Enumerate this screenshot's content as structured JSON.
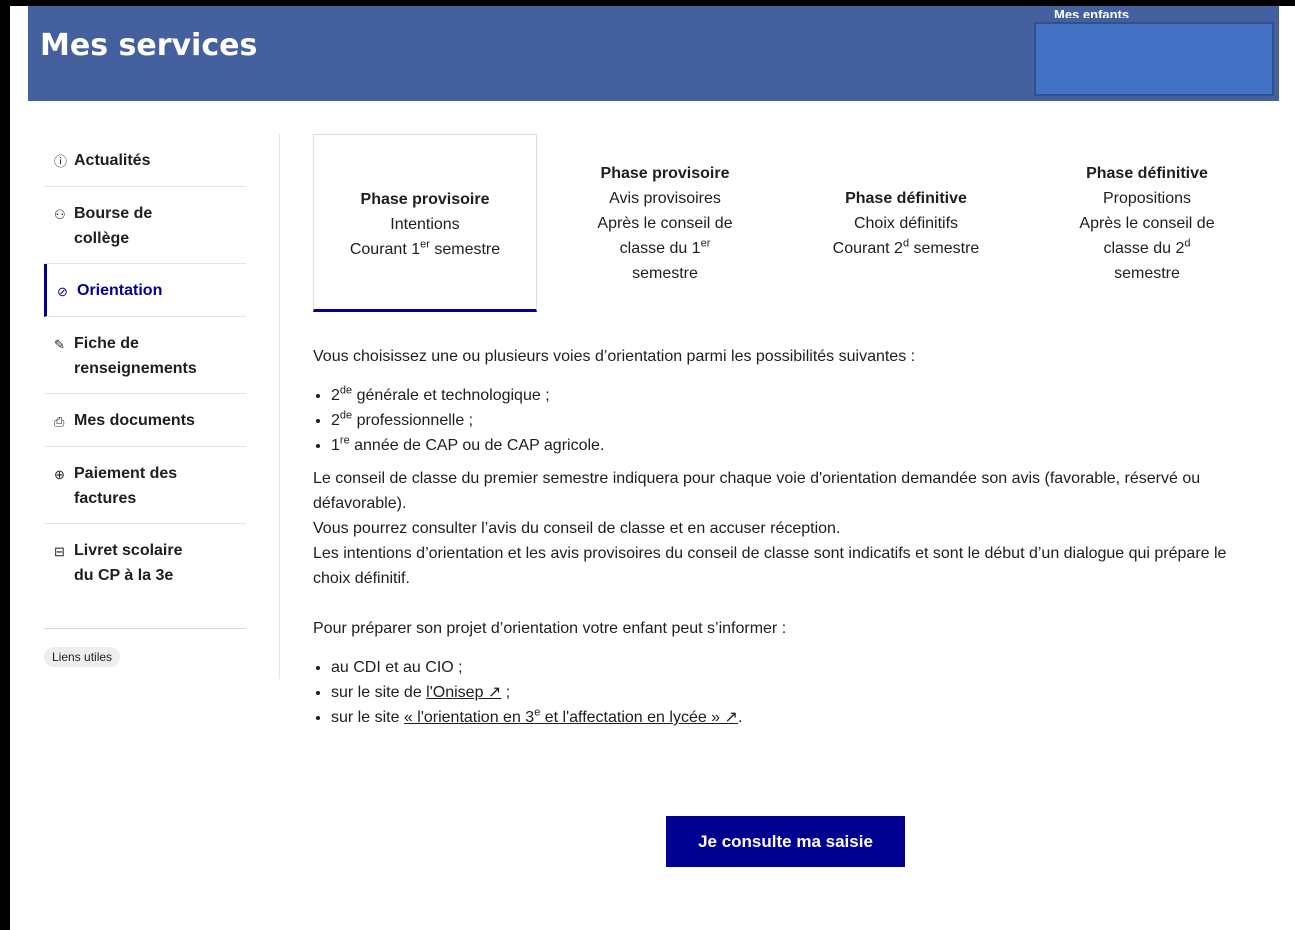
{
  "header": {
    "title": "Mes services",
    "cutoff_text": "Mes enfants"
  },
  "sidebar": {
    "items": [
      {
        "icon": "ⓘ",
        "label": "Actualités"
      },
      {
        "icon": "⚇",
        "label": "Bourse de collège"
      },
      {
        "icon": "⊘",
        "label": "Orientation"
      },
      {
        "icon": "✎",
        "label": "Fiche de renseignements"
      },
      {
        "icon": "⎙",
        "label": "Mes documents"
      },
      {
        "icon": "⊕",
        "label": "Paiement des factures"
      },
      {
        "icon": "⊟",
        "label": "Livret scolaire du CP à la 3e"
      }
    ],
    "liens": "Liens utiles"
  },
  "tabs": [
    {
      "title": "Phase provisoire",
      "line1": "Intentions",
      "line2a": "Courant 1",
      "line2sup": "er",
      "line2b": " semestre"
    },
    {
      "title": "Phase provisoire",
      "line1": "Avis provisoires",
      "line2": "Après le conseil de",
      "line3a": "classe du 1",
      "line3sup": "er",
      "line4": "semestre"
    },
    {
      "title": "Phase définitive",
      "line1": "Choix définitifs",
      "line2a": "Courant 2",
      "line2sup": "d",
      "line2b": " semestre"
    },
    {
      "title": "Phase définitive",
      "line1": "Propositions",
      "line2": "Après le conseil de",
      "line3a": "classe du 2",
      "line3sup": "d",
      "line4": "semestre"
    }
  ],
  "content": {
    "intro": "Vous choisissez une ou plusieurs voies d’orientation parmi les possibilités suivantes :",
    "voies": [
      {
        "a": "2",
        "sup": "de",
        "b": " générale et technologique ;"
      },
      {
        "a": "2",
        "sup": "de",
        "b": " professionnelle ;"
      },
      {
        "a": "1",
        "sup": "re",
        "b": " année de CAP ou de CAP agricole."
      }
    ],
    "para1": "Le conseil de classe du premier semestre indiquera pour chaque voie d'orientation demandée son avis (favorable, réservé ou défavorable).",
    "para2": "Vous pourrez consulter l’avis du conseil de classe et en accuser réception.",
    "para3": "Les intentions d’orientation et les avis provisoires du conseil de classe sont indicatifs et sont le début d’un dialogue qui prépare le choix définitif.",
    "inform": "Pour préparer son projet d’orientation votre enfant peut s’informer :",
    "info1": "au CDI et au CIO ;",
    "info2a": "sur le site de ",
    "info2link": "l'Onisep",
    "info2b": " ;",
    "info3a": "sur le site ",
    "info3link_a": "« l'orientation en 3",
    "info3link_sup": "e",
    "info3link_b": " et l'affectation en lycée »",
    "info3b": ".",
    "ext_icon": "↗"
  },
  "button": {
    "label": "Je consulte ma saisie"
  }
}
